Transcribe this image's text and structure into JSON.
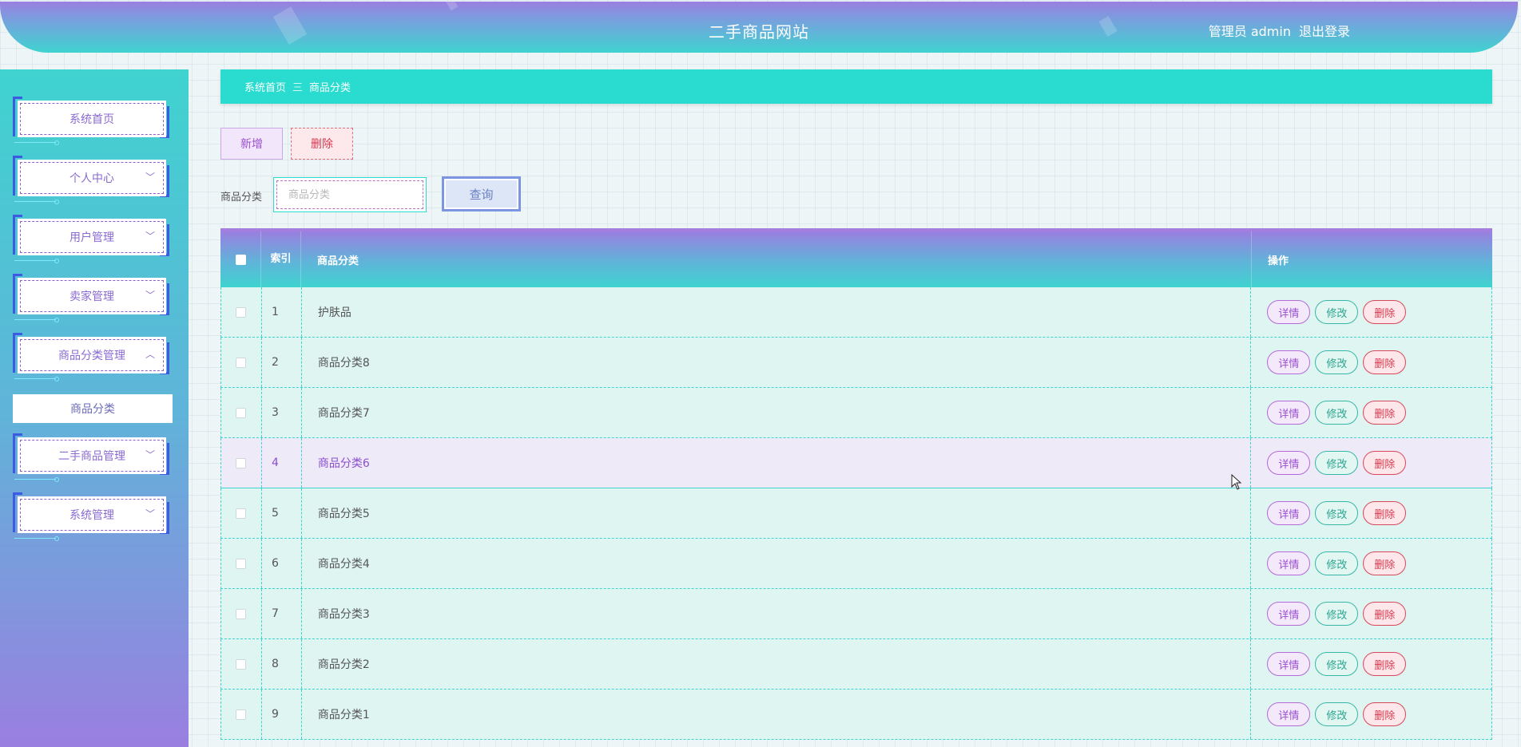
{
  "header": {
    "title": "二手商品网站",
    "role": "管理员 admin",
    "logout": "退出登录"
  },
  "sidebar": {
    "items": [
      {
        "label": "系统首页",
        "chevron": ""
      },
      {
        "label": "个人中心",
        "chevron": "﹀"
      },
      {
        "label": "用户管理",
        "chevron": "﹀"
      },
      {
        "label": "卖家管理",
        "chevron": "﹀"
      },
      {
        "label": "商品分类管理",
        "chevron": "︿"
      },
      {
        "label": "二手商品管理",
        "chevron": "﹀"
      },
      {
        "label": "系统管理",
        "chevron": "﹀"
      }
    ],
    "sub_item": "商品分类"
  },
  "breadcrumb": {
    "home": "系统首页",
    "separator": "三",
    "current": "商品分类"
  },
  "toolbar": {
    "add_label": "新增",
    "delete_label": "删除"
  },
  "search": {
    "label": "商品分类",
    "placeholder": "商品分类",
    "query_label": "查询"
  },
  "table": {
    "headers": {
      "index": "索引",
      "name": "商品分类",
      "ops": "操作"
    },
    "rows": [
      {
        "index": "1",
        "name": "护肤品"
      },
      {
        "index": "2",
        "name": "商品分类8"
      },
      {
        "index": "3",
        "name": "商品分类7"
      },
      {
        "index": "4",
        "name": "商品分类6"
      },
      {
        "index": "5",
        "name": "商品分类5"
      },
      {
        "index": "6",
        "name": "商品分类4"
      },
      {
        "index": "7",
        "name": "商品分类3"
      },
      {
        "index": "8",
        "name": "商品分类2"
      },
      {
        "index": "9",
        "name": "商品分类1"
      }
    ],
    "ops": {
      "detail": "详情",
      "edit": "修改",
      "delete": "删除"
    }
  }
}
